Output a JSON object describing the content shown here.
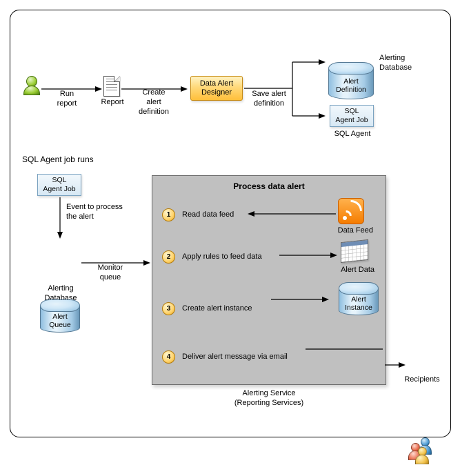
{
  "top": {
    "run_report": "Run\nreport",
    "report_label": "Report",
    "create_def": "Create\nalert\ndefinition",
    "designer": "Data Alert\nDesigner",
    "save_def": "Save alert\ndefinition",
    "alert_def_cyl": "Alert\nDefinition",
    "alerting_db": "Alerting\nDatabase",
    "sql_job": "SQL\nAgent Job",
    "sql_agent": "SQL Agent"
  },
  "mid": {
    "sql_runs": "SQL Agent job runs",
    "sql_job": "SQL\nAgent Job",
    "event_text": "Event to process\nthe alert",
    "alert_queue": "Alert\nQueue",
    "alerting_db": "Alerting\nDatabase",
    "monitor_queue": "Monitor\nqueue"
  },
  "process": {
    "title": "Process data alert",
    "steps": [
      {
        "n": "1",
        "text": "Read data feed",
        "icon_label": "Data Feed"
      },
      {
        "n": "2",
        "text": "Apply rules to feed data",
        "icon_label": "Alert Data"
      },
      {
        "n": "3",
        "text": "Create alert instance",
        "icon_label": "Alert\nInstance"
      },
      {
        "n": "4",
        "text": "Deliver alert message via email",
        "icon_label": "Recipients"
      }
    ],
    "caption": "Alerting Service\n(Reporting Services)"
  },
  "chart_data": {
    "type": "flow-diagram",
    "top_flow": [
      "User runs report",
      "Report",
      "Create alert definition",
      "Data Alert Designer",
      "Save alert definition",
      [
        "Alert Definition (Alerting Database)",
        "SQL Agent Job (SQL Agent)"
      ]
    ],
    "lower_flow": {
      "trigger": "SQL Agent job runs",
      "from": "SQL Agent Job",
      "edge1": "Event to process the alert",
      "to1": "Alert Queue (Alerting Database)",
      "edge2": "Monitor queue",
      "to2": "Alerting Service (Reporting Services) — Process data alert"
    },
    "process_steps": [
      {
        "order": 1,
        "action": "Read data feed",
        "artifact": "Data Feed"
      },
      {
        "order": 2,
        "action": "Apply rules to feed data",
        "artifact": "Alert Data"
      },
      {
        "order": 3,
        "action": "Create alert instance",
        "artifact": "Alert Instance"
      },
      {
        "order": 4,
        "action": "Deliver alert message via email",
        "artifact": "Recipients"
      }
    ]
  }
}
